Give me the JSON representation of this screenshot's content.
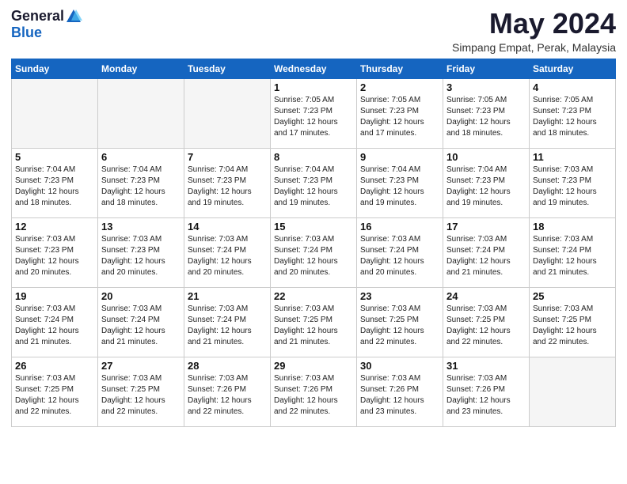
{
  "header": {
    "logo_general": "General",
    "logo_blue": "Blue",
    "month_year": "May 2024",
    "location": "Simpang Empat, Perak, Malaysia"
  },
  "weekdays": [
    "Sunday",
    "Monday",
    "Tuesday",
    "Wednesday",
    "Thursday",
    "Friday",
    "Saturday"
  ],
  "weeks": [
    [
      {
        "day": "",
        "info": ""
      },
      {
        "day": "",
        "info": ""
      },
      {
        "day": "",
        "info": ""
      },
      {
        "day": "1",
        "info": "Sunrise: 7:05 AM\nSunset: 7:23 PM\nDaylight: 12 hours\nand 17 minutes."
      },
      {
        "day": "2",
        "info": "Sunrise: 7:05 AM\nSunset: 7:23 PM\nDaylight: 12 hours\nand 17 minutes."
      },
      {
        "day": "3",
        "info": "Sunrise: 7:05 AM\nSunset: 7:23 PM\nDaylight: 12 hours\nand 18 minutes."
      },
      {
        "day": "4",
        "info": "Sunrise: 7:05 AM\nSunset: 7:23 PM\nDaylight: 12 hours\nand 18 minutes."
      }
    ],
    [
      {
        "day": "5",
        "info": "Sunrise: 7:04 AM\nSunset: 7:23 PM\nDaylight: 12 hours\nand 18 minutes."
      },
      {
        "day": "6",
        "info": "Sunrise: 7:04 AM\nSunset: 7:23 PM\nDaylight: 12 hours\nand 18 minutes."
      },
      {
        "day": "7",
        "info": "Sunrise: 7:04 AM\nSunset: 7:23 PM\nDaylight: 12 hours\nand 19 minutes."
      },
      {
        "day": "8",
        "info": "Sunrise: 7:04 AM\nSunset: 7:23 PM\nDaylight: 12 hours\nand 19 minutes."
      },
      {
        "day": "9",
        "info": "Sunrise: 7:04 AM\nSunset: 7:23 PM\nDaylight: 12 hours\nand 19 minutes."
      },
      {
        "day": "10",
        "info": "Sunrise: 7:04 AM\nSunset: 7:23 PM\nDaylight: 12 hours\nand 19 minutes."
      },
      {
        "day": "11",
        "info": "Sunrise: 7:03 AM\nSunset: 7:23 PM\nDaylight: 12 hours\nand 19 minutes."
      }
    ],
    [
      {
        "day": "12",
        "info": "Sunrise: 7:03 AM\nSunset: 7:23 PM\nDaylight: 12 hours\nand 20 minutes."
      },
      {
        "day": "13",
        "info": "Sunrise: 7:03 AM\nSunset: 7:23 PM\nDaylight: 12 hours\nand 20 minutes."
      },
      {
        "day": "14",
        "info": "Sunrise: 7:03 AM\nSunset: 7:24 PM\nDaylight: 12 hours\nand 20 minutes."
      },
      {
        "day": "15",
        "info": "Sunrise: 7:03 AM\nSunset: 7:24 PM\nDaylight: 12 hours\nand 20 minutes."
      },
      {
        "day": "16",
        "info": "Sunrise: 7:03 AM\nSunset: 7:24 PM\nDaylight: 12 hours\nand 20 minutes."
      },
      {
        "day": "17",
        "info": "Sunrise: 7:03 AM\nSunset: 7:24 PM\nDaylight: 12 hours\nand 21 minutes."
      },
      {
        "day": "18",
        "info": "Sunrise: 7:03 AM\nSunset: 7:24 PM\nDaylight: 12 hours\nand 21 minutes."
      }
    ],
    [
      {
        "day": "19",
        "info": "Sunrise: 7:03 AM\nSunset: 7:24 PM\nDaylight: 12 hours\nand 21 minutes."
      },
      {
        "day": "20",
        "info": "Sunrise: 7:03 AM\nSunset: 7:24 PM\nDaylight: 12 hours\nand 21 minutes."
      },
      {
        "day": "21",
        "info": "Sunrise: 7:03 AM\nSunset: 7:24 PM\nDaylight: 12 hours\nand 21 minutes."
      },
      {
        "day": "22",
        "info": "Sunrise: 7:03 AM\nSunset: 7:25 PM\nDaylight: 12 hours\nand 21 minutes."
      },
      {
        "day": "23",
        "info": "Sunrise: 7:03 AM\nSunset: 7:25 PM\nDaylight: 12 hours\nand 22 minutes."
      },
      {
        "day": "24",
        "info": "Sunrise: 7:03 AM\nSunset: 7:25 PM\nDaylight: 12 hours\nand 22 minutes."
      },
      {
        "day": "25",
        "info": "Sunrise: 7:03 AM\nSunset: 7:25 PM\nDaylight: 12 hours\nand 22 minutes."
      }
    ],
    [
      {
        "day": "26",
        "info": "Sunrise: 7:03 AM\nSunset: 7:25 PM\nDaylight: 12 hours\nand 22 minutes."
      },
      {
        "day": "27",
        "info": "Sunrise: 7:03 AM\nSunset: 7:25 PM\nDaylight: 12 hours\nand 22 minutes."
      },
      {
        "day": "28",
        "info": "Sunrise: 7:03 AM\nSunset: 7:26 PM\nDaylight: 12 hours\nand 22 minutes."
      },
      {
        "day": "29",
        "info": "Sunrise: 7:03 AM\nSunset: 7:26 PM\nDaylight: 12 hours\nand 22 minutes."
      },
      {
        "day": "30",
        "info": "Sunrise: 7:03 AM\nSunset: 7:26 PM\nDaylight: 12 hours\nand 23 minutes."
      },
      {
        "day": "31",
        "info": "Sunrise: 7:03 AM\nSunset: 7:26 PM\nDaylight: 12 hours\nand 23 minutes."
      },
      {
        "day": "",
        "info": ""
      }
    ]
  ]
}
